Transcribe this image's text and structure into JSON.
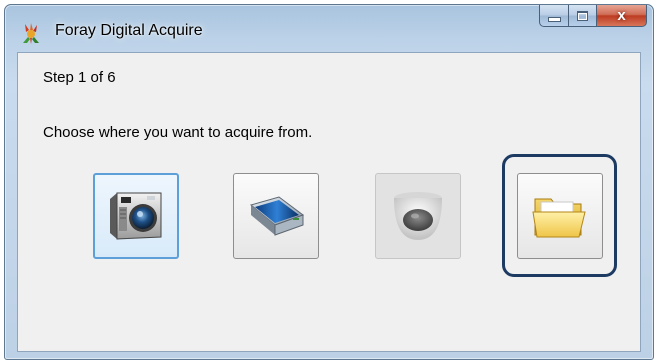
{
  "window": {
    "title": "Foray Digital Acquire",
    "icon": "foray-app-icon",
    "caption_buttons": [
      "minimize",
      "maximize",
      "close"
    ],
    "close_glyph": "x"
  },
  "content": {
    "step_text": "Step 1 of 6",
    "prompt": "Choose where you want to acquire from."
  },
  "sources": [
    {
      "name": "camera",
      "icon": "digital-camera-icon",
      "state": "selected"
    },
    {
      "name": "scanner",
      "icon": "flatbed-scanner-icon",
      "state": "normal"
    },
    {
      "name": "dome-camera",
      "icon": "dome-camera-icon",
      "state": "disabled"
    },
    {
      "name": "folder",
      "icon": "folder-icon",
      "state": "normal",
      "highlighted": true
    }
  ],
  "colors": {
    "selection_border": "#5d9fd8",
    "highlight_ring": "#1d3a63",
    "close_button": "#c94a30"
  }
}
